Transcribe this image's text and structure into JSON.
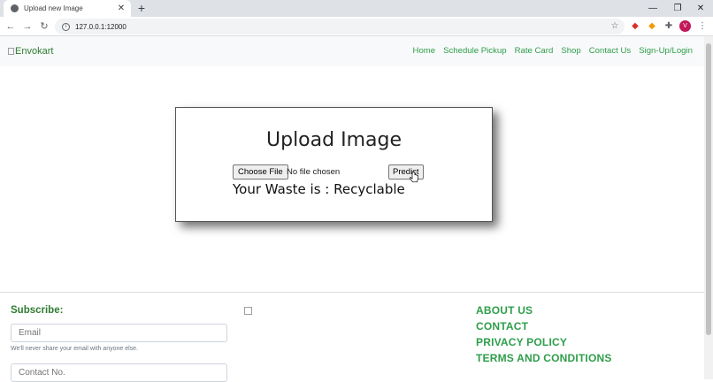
{
  "browser": {
    "tab_title": "Upload new Image",
    "tab_close": "✕",
    "new_tab": "+",
    "url": "127.0.0.1:12000",
    "window_controls": [
      "—",
      "❐",
      "✕"
    ],
    "profile_initial": "V",
    "icons": [
      "back-arrow-icon",
      "forward-arrow-icon",
      "reload-icon",
      "info-icon",
      "star-icon",
      "extension-icons",
      "puzzle-icon",
      "menu-dots-icon"
    ]
  },
  "site": {
    "logo_alt": "Envokart",
    "nav": [
      "Home",
      "Schedule Pickup",
      "Rate Card",
      "Shop",
      "Contact Us",
      "Sign-Up/Login"
    ],
    "accent_color": "#2e9e4a"
  },
  "upload": {
    "heading": "Upload Image",
    "choose_file_label": "Choose File",
    "file_status": "No file chosen",
    "predict_label": "Predict",
    "result": "Your Waste is : Recyclable"
  },
  "footer": {
    "subscribe_title": "Subscribe:",
    "email_placeholder": "Email",
    "email_hint": "We'll never share your email with anyone else.",
    "contact_placeholder": "Contact No.",
    "links": [
      "ABOUT US",
      "CONTACT",
      "PRIVACY POLICY",
      "TERMS AND CONDITIONS"
    ]
  }
}
